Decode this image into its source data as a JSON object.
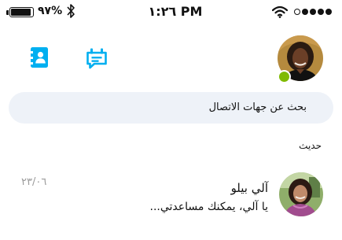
{
  "status_bar": {
    "battery_percent": "٩٧%",
    "battery_level": 0.97,
    "time": "١:٢٦ PM",
    "signal_bars_filled": 4,
    "signal_bars_total": 5,
    "icons": [
      "battery-icon",
      "bluetooth-icon",
      "wifi-icon",
      "signal-icon"
    ]
  },
  "toolbar": {
    "icons": [
      "contacts-icon",
      "new-chat-icon"
    ],
    "presence_color": "#7fba00",
    "accent_color": "#00aff0"
  },
  "search": {
    "placeholder": "بحث عن جهات الاتصال"
  },
  "recent": {
    "section_title": "حديث",
    "items": [
      {
        "name": "آلي بيلو",
        "preview": "يا آلي، يمكنك مساعدتي...",
        "date": "٢٣/٠٦"
      }
    ]
  }
}
